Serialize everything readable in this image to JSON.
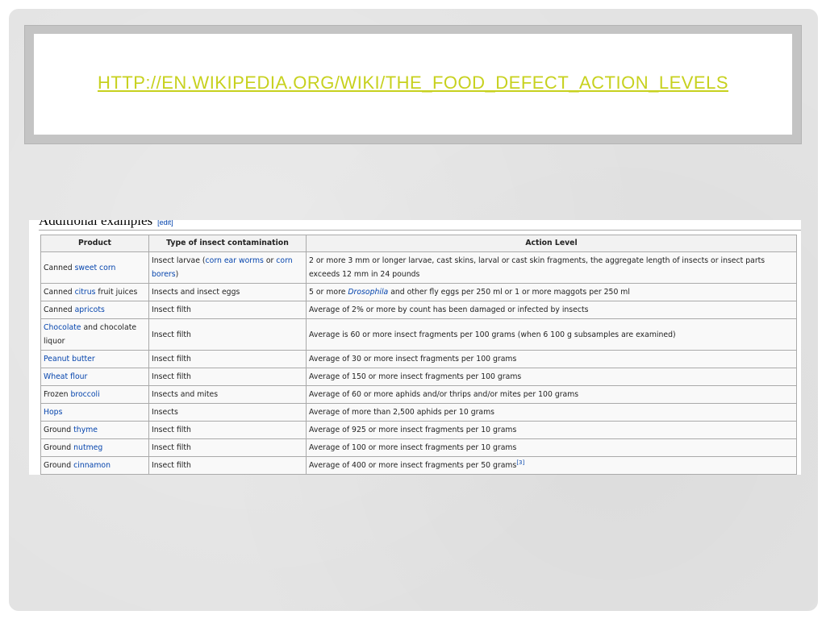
{
  "slide": {
    "title_link": "http://en.wikipedia.org/wiki/The_Food_Defect_Action_Levels"
  },
  "wiki": {
    "section_heading": "Additional examples",
    "edit_label": "[edit]",
    "table": {
      "headers": [
        "Product",
        "Type of insect contamination",
        "Action Level"
      ],
      "rows": [
        {
          "product_prefix": "Canned ",
          "product_link": "sweet corn",
          "product_suffix": "",
          "type_prefix": "Insect larvae (",
          "type_link1": "corn ear worms",
          "type_mid": " or ",
          "type_link2": "corn borers",
          "type_suffix": ")",
          "action": "2 or more 3 mm or longer larvae, cast skins, larval or cast skin fragments, the aggregate length of insects or insect parts exceeds 12 mm in 24 pounds"
        },
        {
          "product_prefix": "Canned ",
          "product_link": "citrus",
          "product_suffix": " fruit juices",
          "type": "Insects and insect eggs",
          "action_prefix": "5 or more ",
          "action_italic": "Drosophila",
          "action_suffix": " and other fly eggs per 250 ml or 1 or more maggots per 250 ml"
        },
        {
          "product_prefix": "Canned ",
          "product_link": "apricots",
          "product_suffix": "",
          "type": "Insect filth",
          "action": "Average of 2% or more by count has been damaged or infected by insects"
        },
        {
          "product_prefix": "",
          "product_link": "Chocolate",
          "product_suffix": " and chocolate liquor",
          "type": "Insect filth",
          "action": "Average is 60 or more insect fragments per 100 grams (when 6 100 g subsamples are examined)"
        },
        {
          "product_prefix": "",
          "product_link": "Peanut butter",
          "product_suffix": "",
          "type": "Insect filth",
          "action": "Average of 30 or more insect fragments per 100 grams"
        },
        {
          "product_prefix": "",
          "product_link": "Wheat flour",
          "product_suffix": "",
          "type": "Insect filth",
          "action": "Average of 150 or more insect fragments per 100 grams"
        },
        {
          "product_prefix": "Frozen ",
          "product_link": "broccoli",
          "product_suffix": "",
          "type": "Insects and mites",
          "action": "Average of 60 or more aphids and/or thrips and/or mites per 100 grams"
        },
        {
          "product_prefix": "",
          "product_link": "Hops",
          "product_suffix": "",
          "type": "Insects",
          "action": "Average of more than 2,500 aphids per 10 grams"
        },
        {
          "product_prefix": "Ground ",
          "product_link": "thyme",
          "product_suffix": "",
          "type": "Insect filth",
          "action": "Average of 925 or more insect fragments per 10 grams"
        },
        {
          "product_prefix": "Ground ",
          "product_link": "nutmeg",
          "product_suffix": "",
          "type": "Insect filth",
          "action": "Average of 100 or more insect fragments per 10 grams"
        },
        {
          "product_prefix": "Ground ",
          "product_link": "cinnamon",
          "product_suffix": "",
          "type": "Insect filth",
          "action": "Average of 400 or more insect fragments per 50 grams",
          "action_ref": "[3]"
        }
      ]
    }
  },
  "colors": {
    "title_link": "#c7d11e",
    "wiki_link": "#0645ad",
    "slide_background": "#e3e3e3"
  }
}
